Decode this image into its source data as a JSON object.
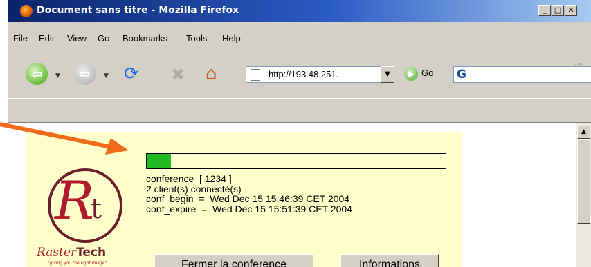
{
  "window": {
    "title": "Document sans titre - Mozilla Firefox",
    "controls": [
      "_",
      "□",
      "✕"
    ]
  },
  "menu": [
    "File",
    "Edit",
    "View",
    "Go",
    "Bookmarks",
    "Tools",
    "Help"
  ],
  "navigation": {
    "url": "http://193.48.251.",
    "go_label": "Go",
    "search_glyph": "G"
  },
  "page": {
    "progress": 0.08,
    "info_lines": [
      "conference  [ 1234 ]",
      "2 client(s) connecté(s)",
      "conf_begin  =  Wed Dec 15 15:46:39 CET 2004",
      "conf_expire  =  Wed Dec 15 15:51:39 CET 2004"
    ],
    "buttons": {
      "close_conference": "Fermer la conference",
      "informations": "Informations"
    },
    "logo": {
      "brand_a": "Raster",
      "brand_b": "Tech",
      "tagline": "\"giving you the right image\""
    }
  },
  "colors": {
    "progress_fill": "#22bb22",
    "panel_bg": "#ffffcc",
    "annotation_arrow": "#f26b1d"
  }
}
